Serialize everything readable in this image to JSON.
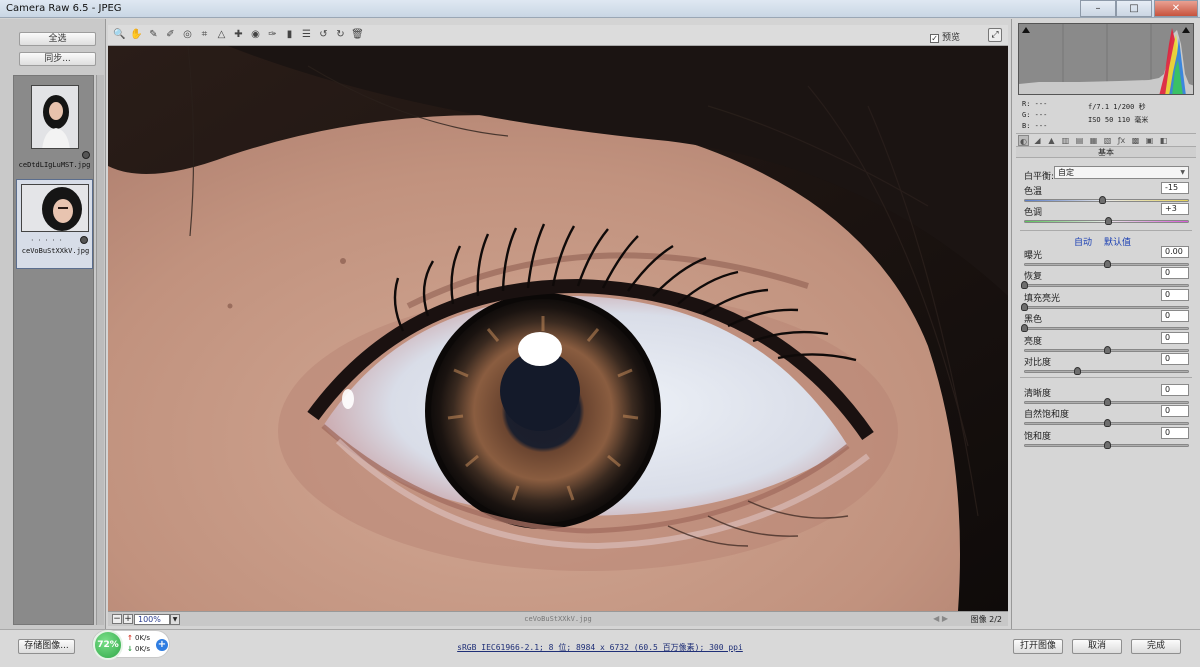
{
  "window": {
    "title": "Camera Raw 6.5 - JPEG",
    "minimize": "–",
    "maximize": "□",
    "close": "✕"
  },
  "filmstrip": {
    "select_all": "全选",
    "sync": "同步...",
    "thumbnails": [
      {
        "filename": "ceDtdLIgLuMST.jpg",
        "selected": false
      },
      {
        "filename": "ceVoBuStXXkV.jpg",
        "selected": true,
        "rating": "· · · · ·"
      }
    ]
  },
  "toolbar": {
    "tools": [
      {
        "name": "zoom-tool",
        "glyph": "🔍"
      },
      {
        "name": "hand-tool",
        "glyph": "✋"
      },
      {
        "name": "white-balance-tool",
        "glyph": "✎"
      },
      {
        "name": "color-sampler-tool",
        "glyph": "✐"
      },
      {
        "name": "targeted-adjustment-tool",
        "glyph": "◎"
      },
      {
        "name": "crop-tool",
        "glyph": "⌗"
      },
      {
        "name": "straighten-tool",
        "glyph": "△"
      },
      {
        "name": "spot-removal-tool",
        "glyph": "✚"
      },
      {
        "name": "red-eye-tool",
        "glyph": "◉"
      },
      {
        "name": "adjustment-brush-tool",
        "glyph": "✑"
      },
      {
        "name": "graduated-filter-tool",
        "glyph": "▮"
      },
      {
        "name": "preferences-tool",
        "glyph": "☰"
      },
      {
        "name": "rotate-left-tool",
        "glyph": "↺"
      },
      {
        "name": "rotate-right-tool",
        "glyph": "↻"
      },
      {
        "name": "trash-tool",
        "glyph": "🗑"
      }
    ],
    "preview_label": "预览",
    "preview_checked": "✓"
  },
  "canvas_bar": {
    "zoom": "100%",
    "minus": "−",
    "plus": "+",
    "filename": "ceVoBuStXXkV.jpg",
    "nav": "◀ ▶",
    "image_count": "图像 2/2"
  },
  "readout": {
    "r": "R:  ---",
    "g": "G:  ---",
    "b": "B:  ---",
    "aperture_shutter": "f/7.1   1/200 秒",
    "iso_focal": "ISO 50   110 毫米"
  },
  "panel": {
    "section_title": "基本",
    "white_balance_label": "白平衡:",
    "white_balance_value": "自定",
    "auto": "自动",
    "default": "默认值",
    "sliders": [
      {
        "id": "temperature",
        "label": "色温",
        "value": "-15",
        "position": 0.47
      },
      {
        "id": "tint",
        "label": "色调",
        "value": "+3",
        "position": 0.51
      },
      {
        "id": "exposure",
        "label": "曝光",
        "value": "0.00",
        "position": 0.5
      },
      {
        "id": "recovery",
        "label": "恢复",
        "value": "0",
        "position": 0.0
      },
      {
        "id": "fill-light",
        "label": "填充亮光",
        "value": "0",
        "position": 0.0
      },
      {
        "id": "blacks",
        "label": "黑色",
        "value": "0",
        "position": 0.0
      },
      {
        "id": "brightness",
        "label": "亮度",
        "value": "0",
        "position": 0.5
      },
      {
        "id": "contrast",
        "label": "对比度",
        "value": "0",
        "position": 0.32
      },
      {
        "id": "clarity",
        "label": "清晰度",
        "value": "0",
        "position": 0.5
      },
      {
        "id": "vibrance",
        "label": "自然饱和度",
        "value": "0",
        "position": 0.5
      },
      {
        "id": "saturation",
        "label": "饱和度",
        "value": "0",
        "position": 0.5
      }
    ]
  },
  "bottom": {
    "save_image": "存储图像...",
    "workflow": "sRGB IEC61966-2.1; 8 位; 8984 x 6732 (60.5 百万像素); 300 ppi",
    "open_image": "打开图像",
    "cancel": "取消",
    "done": "完成"
  },
  "network_widget": {
    "percent": "72%",
    "up_arrow": "↑",
    "up": "0K/s",
    "down_arrow": "↓",
    "down": "0K/s",
    "plus": "+"
  }
}
